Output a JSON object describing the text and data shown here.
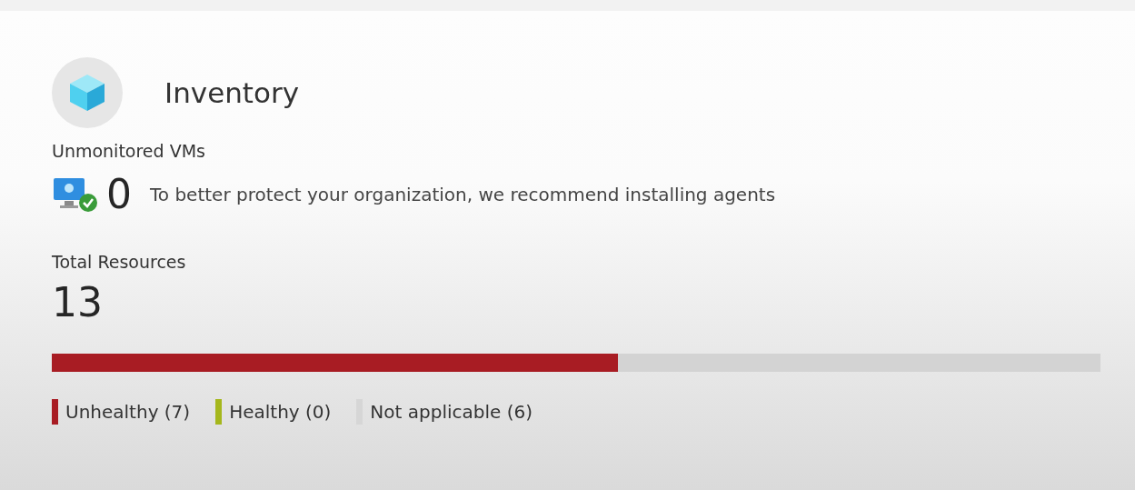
{
  "card": {
    "title": "Inventory"
  },
  "unmonitored": {
    "label": "Unmonitored VMs",
    "count": "0",
    "message": "To better protect your organization, we recommend installing agents"
  },
  "total": {
    "label": "Total Resources",
    "count": "13"
  },
  "health_bar": {
    "level": 0.54,
    "color": "#a81c23"
  },
  "legend": [
    {
      "label": "Unhealthy (7)",
      "color": "#a81c23"
    },
    {
      "label": "Healthy (0)",
      "color": "#a5b71c"
    },
    {
      "label": "Not applicable (6)",
      "color": "#d6d6d6"
    }
  ]
}
